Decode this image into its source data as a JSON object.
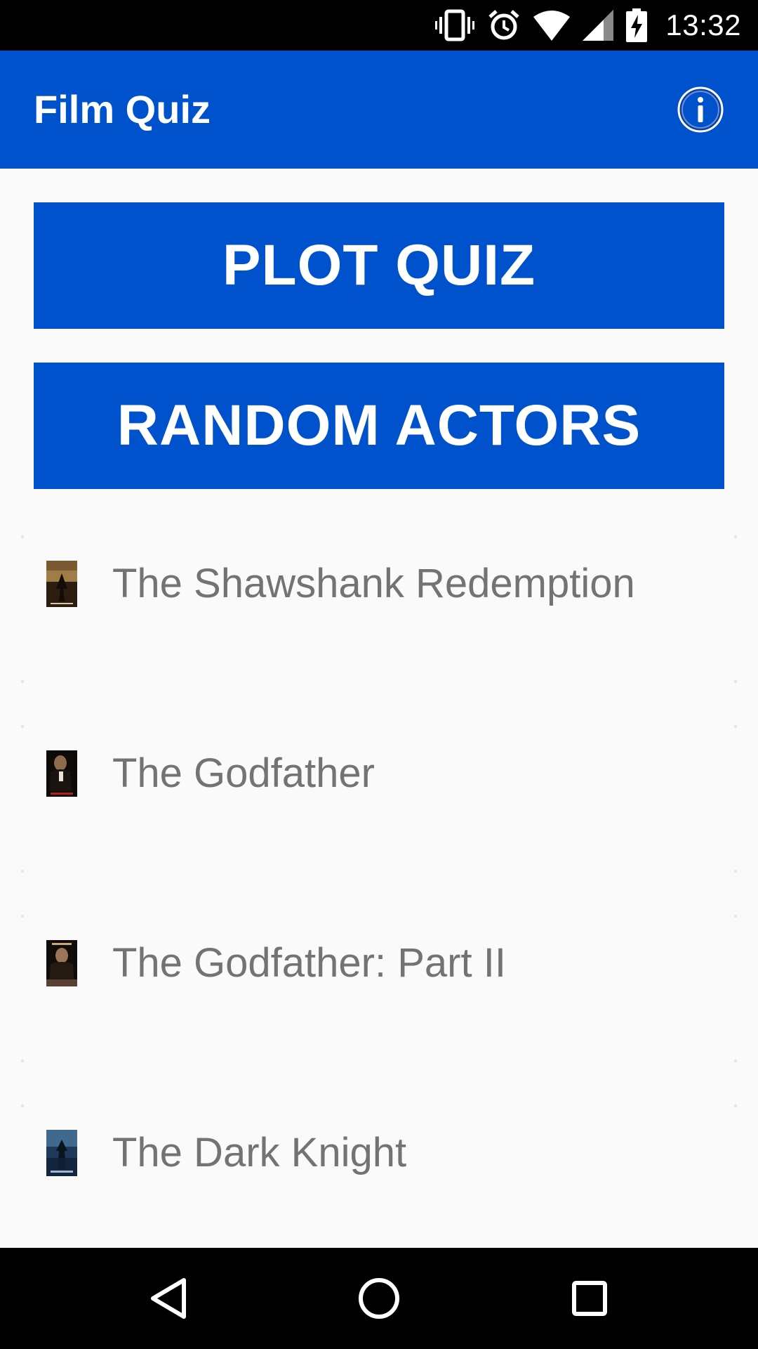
{
  "status_bar": {
    "time": "13:32",
    "icons": [
      "vibrate-icon",
      "alarm-icon",
      "wifi-icon",
      "cell-signal-icon",
      "battery-charging-icon"
    ]
  },
  "app_bar": {
    "title": "Film Quiz",
    "info_icon": "info-icon"
  },
  "actions": {
    "plot_quiz_label": "PLOT QUIZ",
    "random_actors_label": "RANDOM ACTORS"
  },
  "films": [
    {
      "title": "The Shawshank Redemption",
      "poster_icon": "poster-shawshank"
    },
    {
      "title": "The Godfather",
      "poster_icon": "poster-godfather"
    },
    {
      "title": "The Godfather: Part II",
      "poster_icon": "poster-godfather-2"
    },
    {
      "title": "The Dark Knight",
      "poster_icon": "poster-dark-knight"
    }
  ],
  "nav_bar": {
    "icons": [
      "back-icon",
      "home-icon",
      "recents-icon"
    ]
  },
  "colors": {
    "primary": "#0052cc",
    "list_text": "#737373",
    "background": "#fafafa"
  }
}
